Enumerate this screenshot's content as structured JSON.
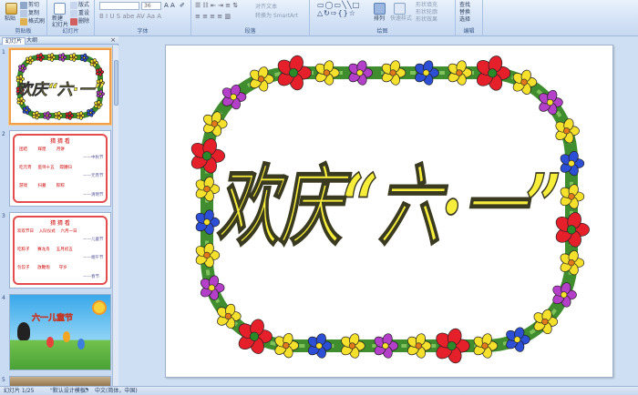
{
  "ribbon": {
    "clipboard": {
      "paste": "粘贴",
      "cut": "剪切",
      "copy": "复制",
      "format_painter": "格式刷",
      "group_label": "剪贴板"
    },
    "slides": {
      "new_slide": "新建\n幻灯片",
      "layout": "版式",
      "reset": "重设",
      "delete": "删除",
      "group_label": "幻灯片"
    },
    "font": {
      "font_size": "36",
      "group_label": "字体"
    },
    "paragraph": {
      "align_text": "对齐文本",
      "convert_smartart": "转换为 SmartArt",
      "group_label": "段落"
    },
    "drawing": {
      "arrange": "排列",
      "quick_styles": "快速样式",
      "shape_fill": "形状填充",
      "shape_outline": "形状轮廓",
      "shape_effects": "形状效果",
      "group_label": "绘图"
    },
    "editing": {
      "find": "查找",
      "replace": "替换",
      "select": "选择",
      "group_label": "编辑"
    }
  },
  "left_panel": {
    "tabs": [
      "幻灯片",
      "大纲"
    ],
    "close": "×",
    "slides": [
      {
        "number": "1",
        "title": "欢庆“六·一”"
      },
      {
        "number": "2",
        "heading": "猜 猜 看",
        "rows": [
          [
            "团结",
            "辉煌",
            "月饼"
          ],
          [
            "吃元宵",
            "巫师十五",
            "嫦娥归"
          ],
          [
            "游戏",
            "扫墓",
            "粽粽"
          ]
        ],
        "answers": [
          "——中秋节",
          "——元宵节",
          "——清明节"
        ]
      },
      {
        "number": "3",
        "heading": "猜 猜 看",
        "rows": [
          [
            "欢欢节日",
            "入队仪式",
            "六月一日"
          ],
          [
            "吃粽子",
            "赛龙舟",
            "五月初五"
          ],
          [
            "包饺子",
            "放鞭炮",
            "守岁"
          ]
        ],
        "answers": [
          "——儿童节",
          "——端午节",
          "——春节"
        ]
      },
      {
        "number": "4",
        "title": "六一儿童节"
      },
      {
        "number": "5"
      }
    ]
  },
  "main_slide": {
    "title": "欢庆“六·一”"
  },
  "status": {
    "slide_counter": "幻灯片 1/25",
    "theme": "\"默认设计模板\"",
    "language": "中文(简体，中国)"
  }
}
